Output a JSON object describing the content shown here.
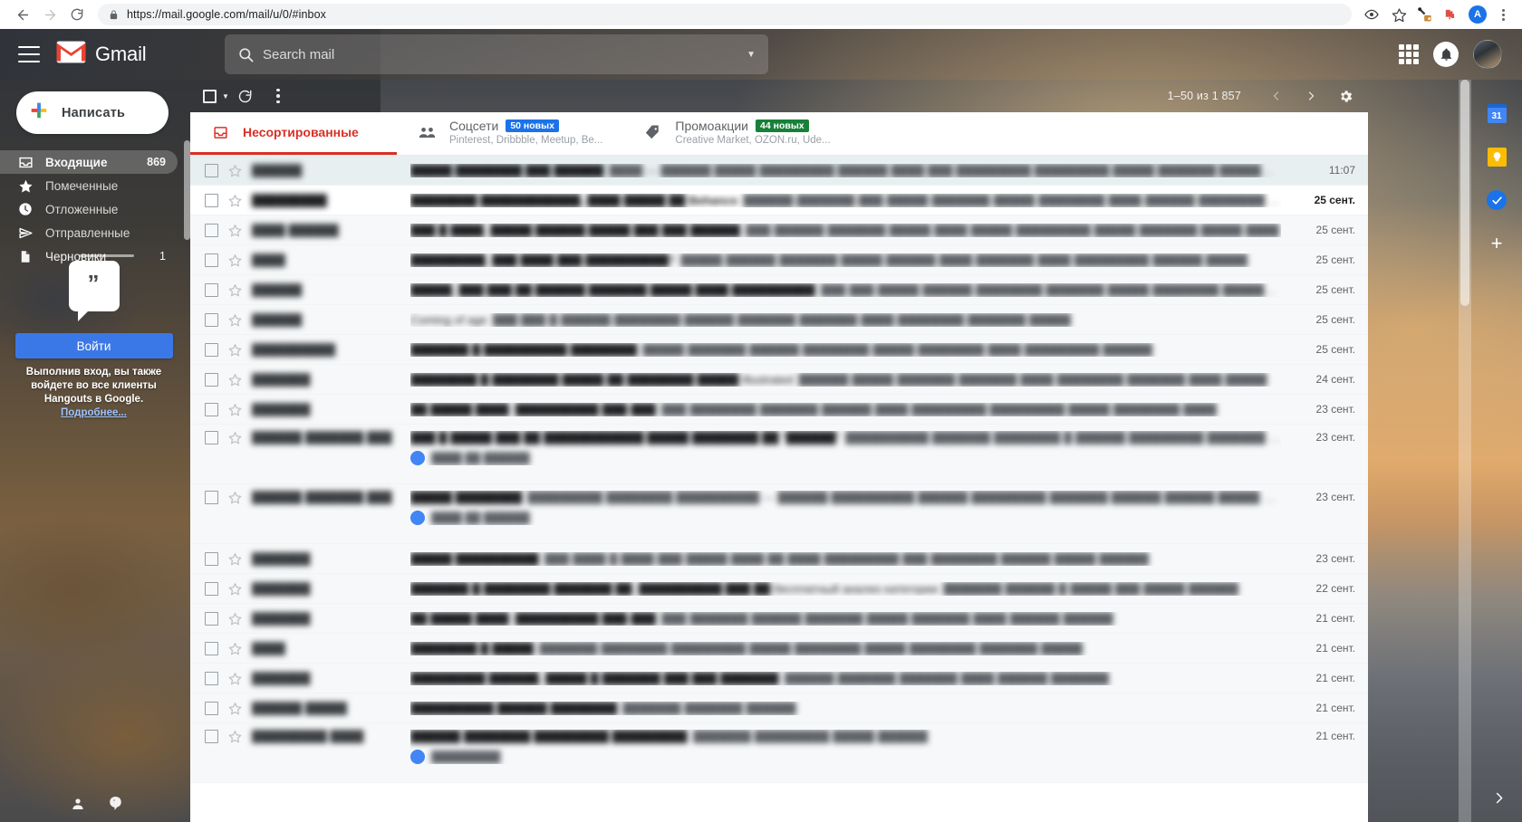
{
  "browser": {
    "url_secure": "https://mail.google.com",
    "url_path": "/mail/u/0/#inbox",
    "url_full": "https://mail.google.com/mail/u/0/#inbox",
    "back_label": "←",
    "forward_label": "→",
    "reload_label": "↻",
    "lock_icon": "lock-icon",
    "eye_icon": "eye-icon",
    "star_icon": "bookmark-star-icon",
    "extension_icon": "extension-icon",
    "profile_initial": "A",
    "menu_icon": "three-dot-menu-icon"
  },
  "header": {
    "menu_icon": "hamburger-menu-icon",
    "logo_text": "Gmail",
    "search_placeholder": "Search mail",
    "search_value": "",
    "search_icon": "search-icon",
    "options_icon": "show-search-options-icon",
    "apps_icon": "google-apps-grid-icon",
    "notifications_icon": "notification-bell-icon",
    "account_icon": "account-avatar"
  },
  "sidebar": {
    "compose_label": "Написать",
    "compose_icon": "plus-icon",
    "items": [
      {
        "label": "Входящие",
        "count": "869",
        "icon": "inbox-icon",
        "active": true
      },
      {
        "label": "Помеченные",
        "count": "",
        "icon": "star-icon",
        "active": false
      },
      {
        "label": "Отложенные",
        "count": "",
        "icon": "clock-icon",
        "active": false
      },
      {
        "label": "Отправленные",
        "count": "",
        "icon": "send-icon",
        "active": false
      },
      {
        "label": "Черновики",
        "count": "1",
        "icon": "draft-file-icon",
        "active": false
      }
    ],
    "hangouts": {
      "bubble_icon": "hangouts-quote-icon",
      "signin_label": "Войти",
      "note_text": "Выполнив вход, вы также войдете во все клиенты Hangouts в Google.",
      "more_label": "Подробнее..."
    },
    "bottom_icons": [
      "person-icon",
      "hangouts-icon"
    ]
  },
  "toolbar": {
    "select_all_icon": "select-all-checkbox",
    "select_caret_icon": "chevron-down-icon",
    "refresh_icon": "refresh-icon",
    "more_icon": "more-options-kebab-icon",
    "pagination": "1–50 из 1 857",
    "prev_icon": "chevron-left-icon",
    "next_icon": "chevron-right-icon",
    "settings_icon": "settings-gear-icon"
  },
  "tabs": [
    {
      "title": "Несортированные",
      "icon": "inbox-primary-icon",
      "badge": "",
      "badge_color": "",
      "subtitle": "",
      "active": true
    },
    {
      "title": "Соцсети",
      "icon": "people-social-icon",
      "badge": "50 новых",
      "badge_color": "#1a73e8",
      "subtitle": "Pinterest, Dribbble, Meetup, Be...",
      "active": false
    },
    {
      "title": "Промоакции",
      "icon": "tag-promotions-icon",
      "badge": "44 новых",
      "badge_color": "#188038",
      "subtitle": "Creative Market, OZON.ru, Ude...",
      "active": false
    }
  ],
  "emails": [
    {
      "sender": "██████",
      "subject": "█████ ████████ ███ ██████",
      "snippet": "████ — ██████ █████ █████████ ██████ ████ ███ █████████ █████████ █████ ███████ ██████ ███",
      "date": "11:07",
      "state": "selected",
      "unread": false,
      "attachment": ""
    },
    {
      "sender": "█████████",
      "subject": "████████ ████████████, ████ █████ ██ Behance",
      "snippet": "██████ ███████ ███ █████ ███████ █████ ████████ ████ ██████ ████████ ███",
      "date": "25 сент.",
      "state": "unread",
      "unread": true,
      "attachment": ""
    },
    {
      "sender": "████ ██████",
      "subject": "███ █ ████, █████ ██████ █████ ███ ███ ██████",
      "snippet": "███ ██████ ███████ █████ ████ █████ █████████ █████ ███████ █████ ████",
      "date": "25 сент.",
      "state": "read",
      "unread": false,
      "attachment": ""
    },
    {
      "sender": "████",
      "subject": "█████████, ███ ████ ███ ██████████?",
      "snippet": "█████ ██████ ███████ █████ ██████ ████ ███████ ████ █████████ ██████ █████",
      "date": "25 сент.",
      "state": "read",
      "unread": false,
      "attachment": ""
    },
    {
      "sender": "██████",
      "subject": "█████, ███ ███ ██ ██████ ███████ █████ ████ ██████████",
      "snippet": "███ ███ █████ ██████ ████████ ███████ █████ ████████ ██████ ████",
      "date": "25 сент.",
      "state": "read",
      "unread": false,
      "attachment": ""
    },
    {
      "sender": "██████",
      "subject": "Coming of age",
      "snippet": "███ ███ █ ██████ ████████ ██████ ███████ ███████ ████ ████████ ███████ █████",
      "date": "25 сент.",
      "state": "read",
      "unread": false,
      "attachment": ""
    },
    {
      "sender": "██████████",
      "subject": "███████ █ ██████████ ████████",
      "snippet": "█████ ███████ ██████ ████████ █████ ████████ ████ █████████ ██████",
      "date": "25 сент.",
      "state": "read",
      "unread": false,
      "attachment": ""
    },
    {
      "sender": "███████",
      "subject": "████████ █ ████████ █████ ██ ████████ █████ Illustrated",
      "snippet": "██████ █████ ███████ ███████ ████ ████████ ███████ ████ █████",
      "date": "24 сент.",
      "state": "read",
      "unread": false,
      "attachment": ""
    },
    {
      "sender": "███████",
      "subject": "██ █████ ████: ██████████ ███-███",
      "snippet": "███ ████████ ███████ ██████ ████ █████████ █████████ █████ ████████ ████",
      "date": "23 сент.",
      "state": "read",
      "unread": false,
      "attachment": ""
    },
    {
      "sender": "██████ ███████ ███",
      "subject": "███ █ █████ ███ ██ ████████████ █████ ████████ ██ “██████”",
      "snippet": "██████████ ███████ ████████ █ ██████ █████████ ███████ █████",
      "date": "23 сент.",
      "state": "read",
      "unread": false,
      "attachment": "████ ██ ██████"
    },
    {
      "sender": "██████ ███████ ███",
      "subject": "█████ ████████",
      "snippet": "█████████ ████████ ██████████ — ██████ ██████████ ██████ █████████ ███████ ██████ ██████ █████ █ ████████",
      "date": "23 сент.",
      "state": "read",
      "unread": false,
      "attachment": "████ ██ ██████"
    },
    {
      "sender": "███████",
      "subject": "█████ ██████████",
      "snippet": "███ ████ █ ████ ███ █████ ████ ██ ████ █████████ ███ ████████ ██████ █████ ██████",
      "date": "23 сент.",
      "state": "read",
      "unread": false,
      "attachment": ""
    },
    {
      "sender": "███████",
      "subject": "███████ █ ████████ ███████ ██. ██████████ ███ ██ бесплатный анализ категории",
      "snippet": "███████ ██████ █ █████ ███ █████ ██████",
      "date": "22 сент.",
      "state": "read",
      "unread": false,
      "attachment": ""
    },
    {
      "sender": "███████",
      "subject": "██ █████ ████: ██████████ ███-███",
      "snippet": "███ ███████ ██████ ███████ █████ ███████ ████ ██████ ██████",
      "date": "21 сент.",
      "state": "read",
      "unread": false,
      "attachment": ""
    },
    {
      "sender": "████",
      "subject": "████████ █ █████",
      "snippet": "███████ ████████ █████████ █████ ████████ █████ ████████ ███████ █████",
      "date": "21 сент.",
      "state": "read",
      "unread": false,
      "attachment": ""
    },
    {
      "sender": "███████",
      "subject": "█████████ ██████, █████ █ ███████ ███ ███ ███████",
      "snippet": "██████ ███████ ███████ ████ ██████ ███████",
      "date": "21 сент.",
      "state": "read",
      "unread": false,
      "attachment": ""
    },
    {
      "sender": "██████ █████",
      "subject": "██████████ ██████ ████████",
      "snippet": "███████ ███████ ██████",
      "date": "21 сент.",
      "state": "read",
      "unread": false,
      "attachment": ""
    },
    {
      "sender": "█████████ ████",
      "subject": "██████ ████████ █████████ █████████",
      "snippet": "███████ █████████ █████ ██████",
      "date": "21 сент.",
      "state": "read",
      "unread": false,
      "attachment": "█████████"
    }
  ],
  "right_rail": {
    "calendar_icon": "google-calendar-icon",
    "calendar_day": "31",
    "keep_icon": "google-keep-icon",
    "tasks_icon": "google-tasks-icon",
    "add_icon": "add-addon-plus-icon",
    "expand_icon": "expand-side-panel-chevron-icon"
  }
}
